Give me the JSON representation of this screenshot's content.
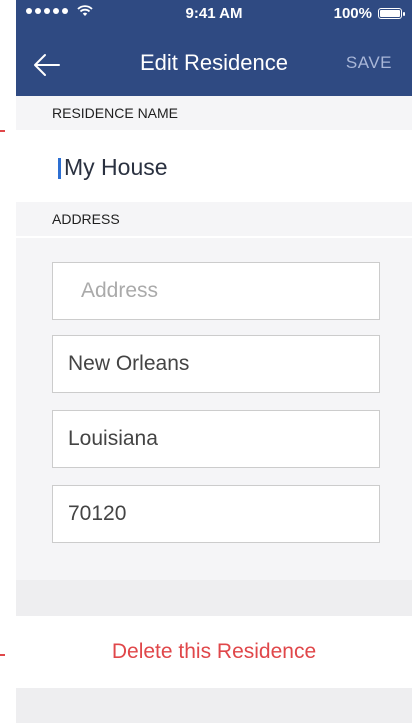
{
  "status_bar": {
    "time": "9:41 AM",
    "battery_label": "100%"
  },
  "nav": {
    "title": "Edit Residence",
    "save_label": "SAVE",
    "back_icon": "arrow-left-icon"
  },
  "residence_name": {
    "section_label": "RESIDENCE NAME",
    "value": "My House"
  },
  "address": {
    "section_label": "ADDRESS",
    "street_placeholder": "Address",
    "city": "New Orleans",
    "state": "Louisiana",
    "zip": "70120"
  },
  "actions": {
    "delete_label": "Delete this Residence"
  },
  "colors": {
    "header_bg": "#2f4a82",
    "delete_red": "#e0474a",
    "caret_blue": "#2d6fd2"
  }
}
